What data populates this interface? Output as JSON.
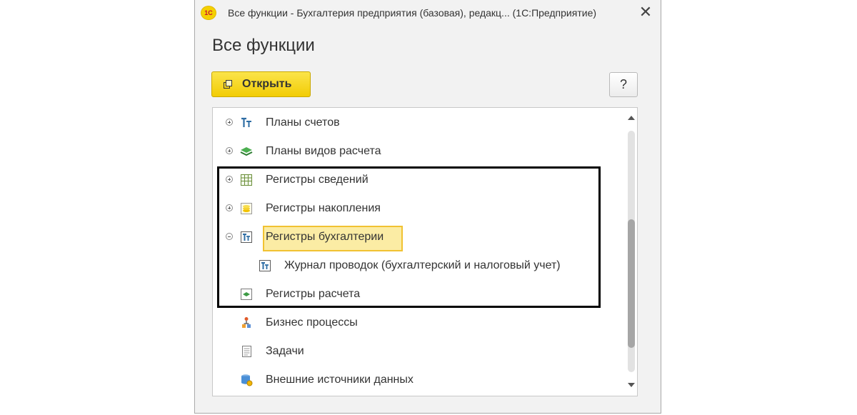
{
  "window": {
    "title": "Все функции - Бухгалтерия предприятия (базовая), редакц...  (1С:Предприятие)",
    "logo_text": "1С",
    "close_symbol": "✕"
  },
  "page": {
    "title": "Все функции"
  },
  "toolbar": {
    "open_label": "Открыть",
    "help_label": "?"
  },
  "tree": {
    "items": [
      {
        "label": "Планы счетов",
        "icon": "chart-of-accounts-icon",
        "expander": "plus"
      },
      {
        "label": "Планы видов расчета",
        "icon": "calculation-types-icon",
        "expander": "plus"
      },
      {
        "label": "Регистры сведений",
        "icon": "info-register-icon",
        "expander": "plus"
      },
      {
        "label": "Регистры накопления",
        "icon": "accumulation-register-icon",
        "expander": "plus"
      },
      {
        "label": "Регистры бухгалтерии",
        "icon": "accounting-register-icon",
        "expander": "minus",
        "selected": true
      },
      {
        "label": "Журнал проводок (бухгалтерский и налоговый учет)",
        "icon": "accounting-register-icon",
        "expander": "none",
        "level": 1
      },
      {
        "label": "Регистры расчета",
        "icon": "calculation-register-icon",
        "expander": "none"
      },
      {
        "label": "Бизнес процессы",
        "icon": "business-process-icon",
        "expander": "none"
      },
      {
        "label": "Задачи",
        "icon": "tasks-icon",
        "expander": "none"
      },
      {
        "label": "Внешние источники данных",
        "icon": "external-data-sources-icon",
        "expander": "none"
      }
    ]
  },
  "colors": {
    "accent_yellow": "#f2cc05",
    "selection_fill": "#fbeca4",
    "selection_border": "#f1c232",
    "highlight_frame": "#000000"
  }
}
